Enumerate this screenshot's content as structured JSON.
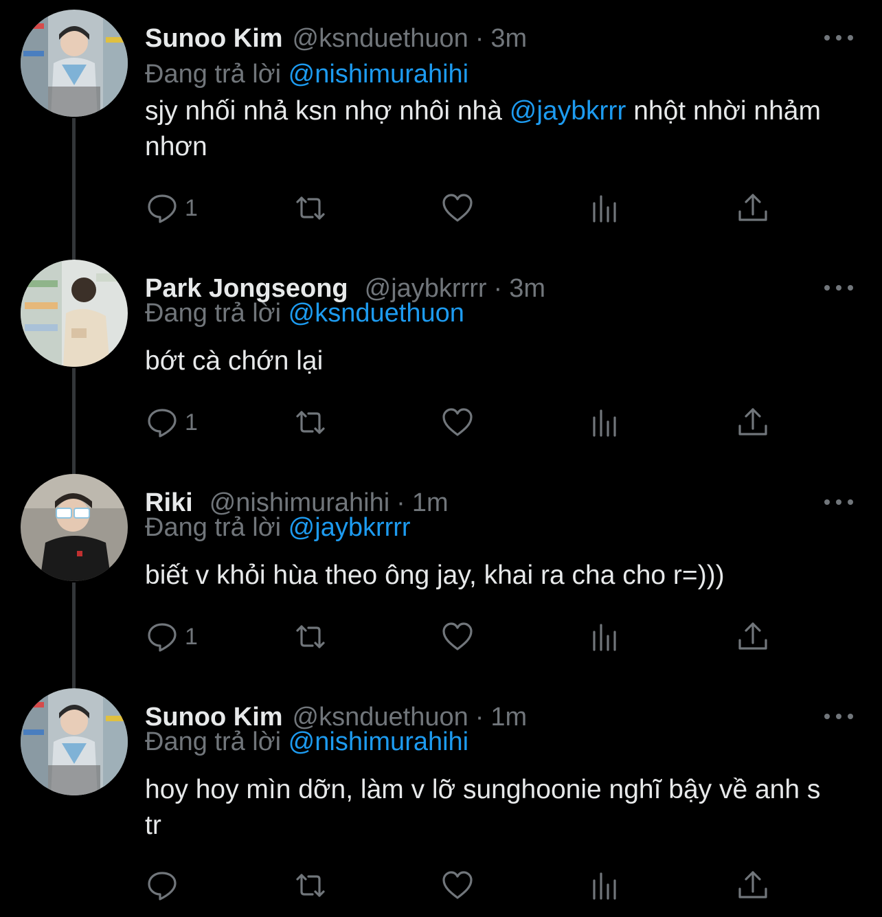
{
  "reply_label": "Đang trả lời",
  "tweets": [
    {
      "name": "Sunoo Kim",
      "handle": "@ksnduethuon",
      "separator": "·",
      "time": "3m",
      "reply_to": "@nishimurahihi",
      "text_before": "sjy nhối nhả ksn nhợ nhôi nhà ",
      "mention": "@jaybkrrr",
      "text_after": " nhột nhời nhảm nhơn",
      "reply_count": "1",
      "avatar_icon": "avatar-photo-sunoo"
    },
    {
      "name": "Park Jongseong",
      "handle": "@jaybkrrrr",
      "separator": "·",
      "time": "3m",
      "reply_to": "@ksnduethuon",
      "text_before": "bớt cà chớn lại",
      "mention": "",
      "text_after": "",
      "reply_count": "1",
      "avatar_icon": "avatar-photo-jongseong"
    },
    {
      "name": "Riki",
      "handle": "@nishimurahihi",
      "separator": "·",
      "time": "1m",
      "reply_to": "@jaybkrrrr",
      "text_before": "biết v khỏi hùa theo ông jay, khai ra cha cho r=)))",
      "mention": "",
      "text_after": "",
      "reply_count": "1",
      "avatar_icon": "avatar-photo-riki"
    },
    {
      "name": "Sunoo Kim",
      "handle": "@ksnduethuon",
      "separator": "·",
      "time": "1m",
      "reply_to": "@nishimurahihi",
      "text_before": "hoy hoy mìn dỡn, làm v lỡ sunghoonie nghĩ bậy về anh s tr",
      "mention": "",
      "text_after": "",
      "reply_count": "",
      "avatar_icon": "avatar-photo-sunoo"
    }
  ],
  "icons": [
    "reply-icon",
    "retweet-icon",
    "like-icon",
    "views-icon",
    "share-icon",
    "more-icon"
  ],
  "colors": {
    "background": "#000000",
    "text": "#e7e9ea",
    "muted": "#71767b",
    "link": "#1d9bf0",
    "thread_line": "#333639"
  }
}
